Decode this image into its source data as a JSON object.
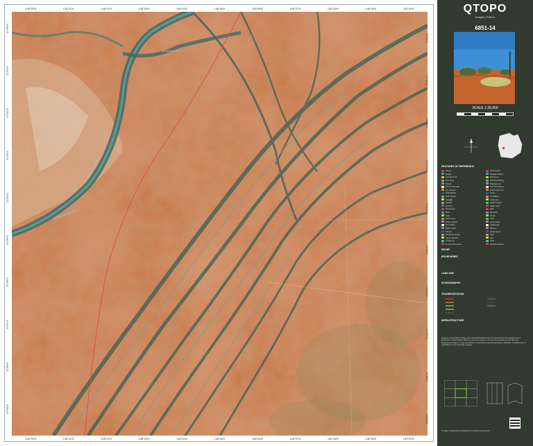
{
  "map": {
    "top_labels": [
      "138°50'E",
      "138°51'E",
      "138°52'E",
      "138°53'E",
      "138°54'E",
      "138°55'E",
      "138°56'E",
      "138°57'E",
      "138°58'E",
      "138°59'E",
      "139°00'E"
    ],
    "bottom_labels": [
      "138°50'E",
      "138°51'E",
      "138°52'E",
      "138°53'E",
      "138°54'E",
      "138°55'E",
      "138°56'E",
      "138°57'E",
      "138°58'E",
      "138°59'E",
      "139°00'E"
    ],
    "left_labels": [
      "21°50'S",
      "21°51'S",
      "21°52'S",
      "21°53'S",
      "21°54'S",
      "21°55'S",
      "21°56'S",
      "21°57'S",
      "21°58'S",
      "21°59'S"
    ],
    "right_labels": [
      "21°50'S",
      "21°51'S",
      "21°52'S",
      "21°53'S",
      "21°54'S",
      "21°55'S",
      "21°56'S",
      "21°57'S",
      "21°58'S",
      "21°59'S"
    ],
    "colors": {
      "terrain": "#c8703f",
      "riverbed": "#3e6b66",
      "sand": "#d9b89a",
      "road": "#c84a4a"
    }
  },
  "sidebar": {
    "title": "QTOPO",
    "subtitle": "Imagery Edition",
    "sheet_number": "6851-14",
    "scale": "SCALE 1:25,000",
    "section_features": "FEATURES OF REFERENCE",
    "section_relief": "RELIEF",
    "section_boundaries": "BOUNDARIES",
    "section_land_use": "LAND USE",
    "section_hydrography": "HYDROGRAPHY",
    "section_transportation": "TRANSPORTATION",
    "section_infrastructure": "INFRASTRUCTURE",
    "legend_colors": [
      "#e04040",
      "#40a0e0",
      "#f0c040",
      "#60c060",
      "#d070d0",
      "#ffffff",
      "#f08030",
      "#2060c0",
      "#a0a0a0",
      "#e0e040",
      "#40c0c0",
      "#c04080"
    ],
    "legend_items": [
      "Airport",
      "Bridge",
      "Campground",
      "Cemetery",
      "Church",
      "Community Hall",
      "Fire Station",
      "Fish Habitat",
      "Golf Course",
      "Hospital",
      "Landfill",
      "Lookout",
      "Monument",
      "Mine",
      "Park",
      "Picnic Area",
      "Police Station",
      "Post Office",
      "Public Toilet",
      "School",
      "Shopping Centre",
      "Sports Ground",
      "Telephone",
      "Tourist Information"
    ],
    "legend_items_b": [
      "Racecourse",
      "Railway Station",
      "Rest Area",
      "Shooting Range",
      "Showground",
      "Surf Life Saving",
      "Swimming Pool",
      "Tower",
      "TV Station",
      "University",
      "Visitor Centre",
      "Water Tank",
      "Weir",
      "Windmill",
      "Wreck",
      "Yard",
      "Homestead",
      "Lighthouse",
      "Marina",
      "Observatory",
      "Ruin",
      "Silo",
      "Tank",
      "Weather Station"
    ],
    "footer_text": "Imagery: Queensland Globe. Grid: GDA2020 MGA Zone 54. Produced by the Department of Resources, Queensland. While every care is taken to ensure the accuracy of this data, the Department makes no representations or warranties about its accuracy, reliability, completeness or suitability for any particular purpose.",
    "copyright": "© State of Queensland (Department of Resources) 2023"
  }
}
